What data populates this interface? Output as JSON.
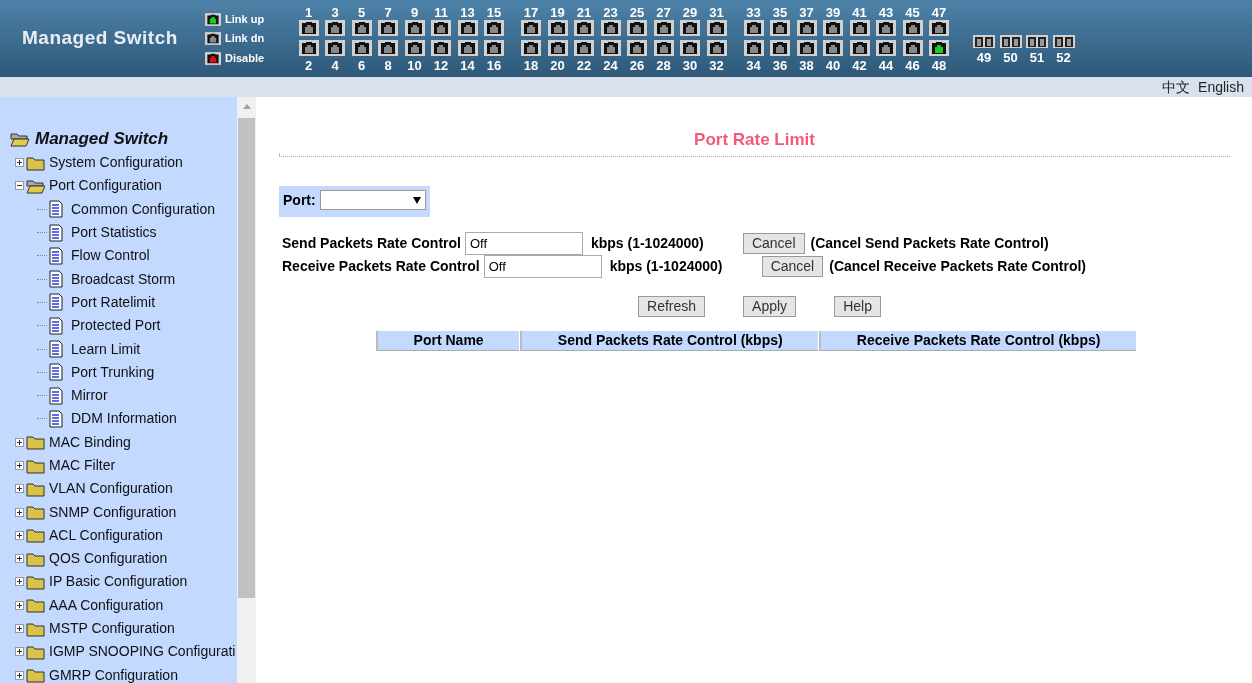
{
  "header": {
    "title": "Managed Switch",
    "legend": [
      {
        "label": "Link up",
        "kind": "up"
      },
      {
        "label": "Link dn",
        "kind": "down"
      },
      {
        "label": "Disable",
        "kind": "disable"
      }
    ],
    "port_groups": [
      {
        "kind": "rj45",
        "columns": [
          {
            "top": {
              "label": "1",
              "link_up": false
            },
            "bottom": {
              "label": "2",
              "link_up": false
            }
          },
          {
            "top": {
              "label": "3",
              "link_up": false
            },
            "bottom": {
              "label": "4",
              "link_up": false
            }
          },
          {
            "top": {
              "label": "5",
              "link_up": false
            },
            "bottom": {
              "label": "6",
              "link_up": false
            }
          },
          {
            "top": {
              "label": "7",
              "link_up": false
            },
            "bottom": {
              "label": "8",
              "link_up": false
            }
          },
          {
            "top": {
              "label": "9",
              "link_up": false
            },
            "bottom": {
              "label": "10",
              "link_up": false
            }
          },
          {
            "top": {
              "label": "11",
              "link_up": false
            },
            "bottom": {
              "label": "12",
              "link_up": false
            }
          },
          {
            "top": {
              "label": "13",
              "link_up": false
            },
            "bottom": {
              "label": "14",
              "link_up": false
            }
          },
          {
            "top": {
              "label": "15",
              "link_up": false
            },
            "bottom": {
              "label": "16",
              "link_up": false
            }
          }
        ]
      },
      {
        "kind": "rj45",
        "columns": [
          {
            "top": {
              "label": "17",
              "link_up": false
            },
            "bottom": {
              "label": "18",
              "link_up": false
            }
          },
          {
            "top": {
              "label": "19",
              "link_up": false
            },
            "bottom": {
              "label": "20",
              "link_up": false
            }
          },
          {
            "top": {
              "label": "21",
              "link_up": false
            },
            "bottom": {
              "label": "22",
              "link_up": false
            }
          },
          {
            "top": {
              "label": "23",
              "link_up": false
            },
            "bottom": {
              "label": "24",
              "link_up": false
            }
          },
          {
            "top": {
              "label": "25",
              "link_up": false
            },
            "bottom": {
              "label": "26",
              "link_up": false
            }
          },
          {
            "top": {
              "label": "27",
              "link_up": false
            },
            "bottom": {
              "label": "28",
              "link_up": false
            }
          },
          {
            "top": {
              "label": "29",
              "link_up": false
            },
            "bottom": {
              "label": "30",
              "link_up": false
            }
          },
          {
            "top": {
              "label": "31",
              "link_up": false
            },
            "bottom": {
              "label": "32",
              "link_up": false
            }
          }
        ]
      },
      {
        "kind": "rj45",
        "columns": [
          {
            "top": {
              "label": "33",
              "link_up": false
            },
            "bottom": {
              "label": "34",
              "link_up": false
            }
          },
          {
            "top": {
              "label": "35",
              "link_up": false
            },
            "bottom": {
              "label": "36",
              "link_up": false
            }
          },
          {
            "top": {
              "label": "37",
              "link_up": false
            },
            "bottom": {
              "label": "38",
              "link_up": false
            }
          },
          {
            "top": {
              "label": "39",
              "link_up": false
            },
            "bottom": {
              "label": "40",
              "link_up": false
            }
          },
          {
            "top": {
              "label": "41",
              "link_up": false
            },
            "bottom": {
              "label": "42",
              "link_up": false
            }
          },
          {
            "top": {
              "label": "43",
              "link_up": false
            },
            "bottom": {
              "label": "44",
              "link_up": false
            }
          },
          {
            "top": {
              "label": "45",
              "link_up": false
            },
            "bottom": {
              "label": "46",
              "link_up": false
            }
          },
          {
            "top": {
              "label": "47",
              "link_up": false
            },
            "bottom": {
              "label": "48",
              "link_up": true
            }
          }
        ]
      },
      {
        "kind": "sfp",
        "columns": [
          {
            "bottom": {
              "label": "49",
              "link_up": false
            }
          },
          {
            "bottom": {
              "label": "50",
              "link_up": false
            }
          },
          {
            "bottom": {
              "label": "51",
              "link_up": false
            }
          },
          {
            "bottom": {
              "label": "52",
              "link_up": false
            }
          }
        ]
      }
    ]
  },
  "languages": [
    {
      "label": "中文"
    },
    {
      "label": "English"
    }
  ],
  "sidebar": {
    "root": "Managed Switch",
    "items": [
      {
        "label": "System Configuration",
        "expanded": false
      },
      {
        "label": "Port Configuration",
        "expanded": true,
        "children": [
          {
            "label": "Common Configuration"
          },
          {
            "label": "Port Statistics"
          },
          {
            "label": "Flow Control"
          },
          {
            "label": "Broadcast Storm"
          },
          {
            "label": "Port Ratelimit"
          },
          {
            "label": "Protected Port"
          },
          {
            "label": "Learn Limit"
          },
          {
            "label": "Port Trunking"
          },
          {
            "label": "Mirror"
          },
          {
            "label": "DDM Information"
          }
        ]
      },
      {
        "label": "MAC Binding",
        "expanded": false
      },
      {
        "label": "MAC Filter",
        "expanded": false
      },
      {
        "label": "VLAN Configuration",
        "expanded": false
      },
      {
        "label": "SNMP Configuration",
        "expanded": false
      },
      {
        "label": "ACL Configuration",
        "expanded": false
      },
      {
        "label": "QOS Configuration",
        "expanded": false
      },
      {
        "label": "IP Basic Configuration",
        "expanded": false
      },
      {
        "label": "AAA Configuration",
        "expanded": false
      },
      {
        "label": "MSTP Configuration",
        "expanded": false
      },
      {
        "label": "IGMP SNOOPING Configurati",
        "expanded": false
      },
      {
        "label": "GMRP Configuration",
        "expanded": false
      }
    ]
  },
  "main": {
    "title": "Port Rate Limit",
    "port_label": "Port:",
    "rows": [
      {
        "label": "Send Packets Rate Control",
        "value": "Off",
        "unit": "kbps (1-1024000)",
        "button": "Cancel",
        "note": "(Cancel Send Packets Rate Control)"
      },
      {
        "label": "Receive Packets Rate Control",
        "value": "Off",
        "unit": "kbps (1-1024000)",
        "button": "Cancel",
        "note": "(Cancel Receive Packets Rate Control)"
      }
    ],
    "buttons": [
      "Refresh",
      "Apply",
      "Help"
    ],
    "table": {
      "columns": [
        "Port Name",
        "Send Packets Rate Control (kbps)",
        "Receive Packets Rate Control (kbps)"
      ]
    }
  }
}
